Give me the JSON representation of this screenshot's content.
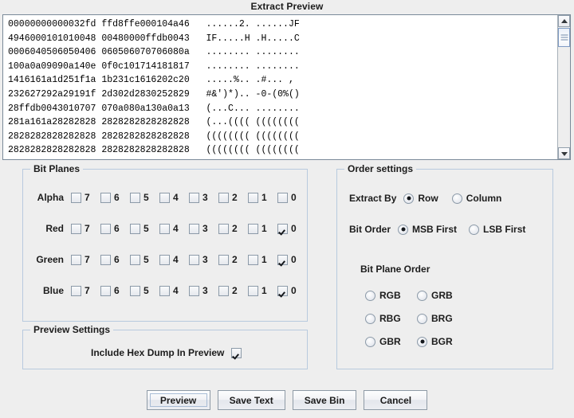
{
  "dialog": {
    "title": "Extract Preview"
  },
  "preview": {
    "hexdump": "00000000000032fd ffd8ffe000104a46   ......2. ......JF\n4946000101010048 00480000ffdb0043   IF.....H .H.....C\n0006040506050406 060506070706080a   ........ ........\n100a0a09090a140e 0f0c101714181817   ........ ........\n1416161a1d251f1a 1b231c1616202c20   .....%.. .#... ,\n232627292a29191f 2d302d2830252829   #&')*).. -0-(0%()\n28ffdb0043010707 070a080a130a0a13   (...C... ........\n281a161a28282828 2828282828282828   (...(((( ((((((((\n2828282828282828 2828282828282828   (((((((( ((((((((\n2828282828282828 2828282828282828   (((((((( ((((((((",
    "scrollbar": {
      "up_arrow": "scroll-up-arrow",
      "down_arrow": "scroll-down-arrow"
    }
  },
  "bit_planes": {
    "title": "Bit Planes",
    "bit_numbers": [
      "7",
      "6",
      "5",
      "4",
      "3",
      "2",
      "1",
      "0"
    ],
    "rows": [
      {
        "label": "Alpha",
        "checked": [
          false,
          false,
          false,
          false,
          false,
          false,
          false,
          false
        ]
      },
      {
        "label": "Red",
        "checked": [
          false,
          false,
          false,
          false,
          false,
          false,
          false,
          true
        ]
      },
      {
        "label": "Green",
        "checked": [
          false,
          false,
          false,
          false,
          false,
          false,
          false,
          true
        ]
      },
      {
        "label": "Blue",
        "checked": [
          false,
          false,
          false,
          false,
          false,
          false,
          false,
          true
        ]
      }
    ]
  },
  "order_settings": {
    "title": "Order settings",
    "extract_by": {
      "label": "Extract By",
      "options": [
        "Row",
        "Column"
      ],
      "selected": "Row"
    },
    "bit_order": {
      "label": "Bit Order",
      "options": [
        "MSB First",
        "LSB First"
      ],
      "selected": "MSB First"
    },
    "bit_plane_order": {
      "label": "Bit Plane Order",
      "options": [
        "RGB",
        "GRB",
        "RBG",
        "BRG",
        "GBR",
        "BGR"
      ],
      "selected": "BGR"
    }
  },
  "preview_settings": {
    "title": "Preview Settings",
    "include_hex_dump": {
      "label": "Include Hex Dump In Preview",
      "checked": true
    }
  },
  "buttons": [
    {
      "label": "Preview",
      "focused": true
    },
    {
      "label": "Save Text",
      "focused": false
    },
    {
      "label": "Save Bin",
      "focused": false
    },
    {
      "label": "Cancel",
      "focused": false
    }
  ],
  "colors": {
    "background": "#eeeeee",
    "panel_border": "#b8cade",
    "text": "#1c1c1c",
    "preview_bg": "#ffffff",
    "scroll_thumb": "#7f9bc4"
  }
}
